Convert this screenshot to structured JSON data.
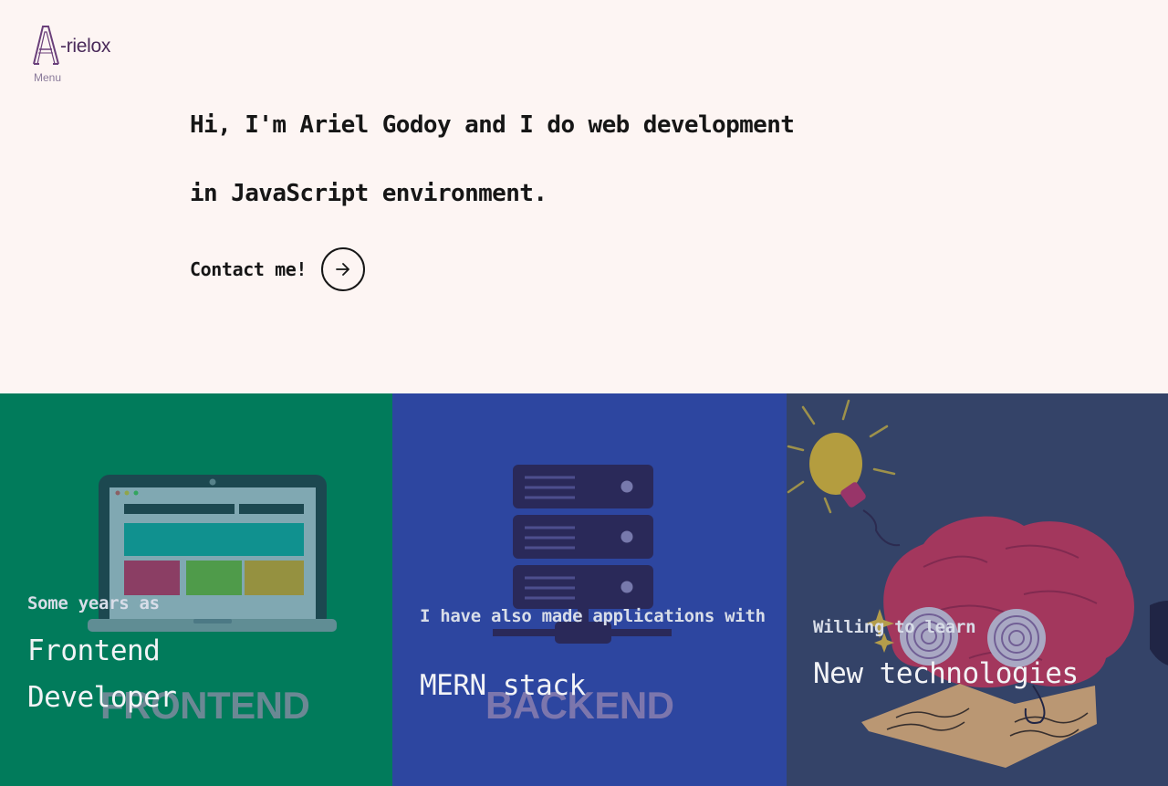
{
  "brand": {
    "logo_text": "-rielox",
    "logo_icon": "letter-a-logo-icon"
  },
  "nav": {
    "menu_label": "Menu"
  },
  "hero": {
    "line1": "Hi, I'm Ariel Godoy and I do web development",
    "line2": "in JavaScript environment."
  },
  "contact": {
    "label": "Contact me!",
    "icon": "arrow-right-icon"
  },
  "panels": [
    {
      "subtitle": "Some years as",
      "title": "Frontend Developer",
      "watermark": "FRONTEND",
      "illustration": "laptop-icon",
      "color": "#017b5b"
    },
    {
      "subtitle": "I have also made applications with",
      "title": "MERN stack",
      "watermark": "BACKEND",
      "illustration": "server-icon",
      "color": "#2d46a0"
    },
    {
      "subtitle": "Willing to learn",
      "title": "New technologies",
      "illustration": "brain-lightbulb-icon",
      "color": "#344368"
    }
  ]
}
